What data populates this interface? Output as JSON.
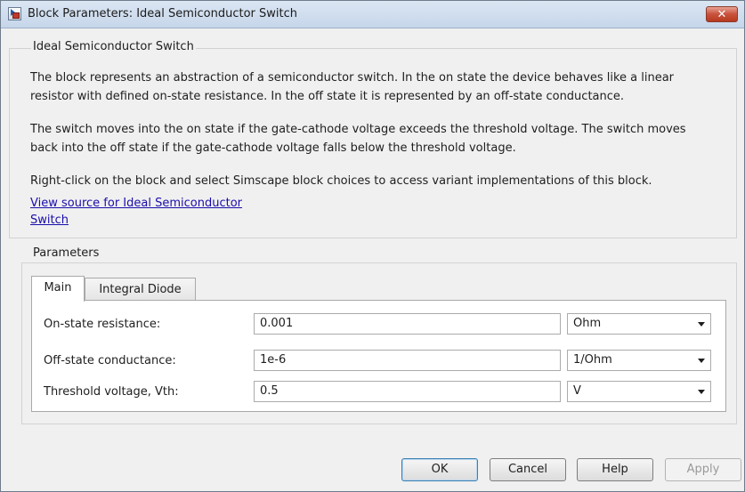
{
  "window": {
    "title": "Block Parameters: Ideal Semiconductor Switch",
    "close_label": "✕"
  },
  "description": {
    "group_title": "Ideal Semiconductor Switch",
    "paragraph1_line1": "The block represents an abstraction of a semiconductor switch. In the on state the device behaves like a linear",
    "paragraph1_line2": "resistor with defined on-state resistance. In the off state it is represented by an off-state conductance.",
    "paragraph2_line1": "The switch moves into the on state if the gate-cathode voltage exceeds the threshold voltage. The switch moves",
    "paragraph2_line2": "back into the off state if the gate-cathode voltage falls below the threshold voltage.",
    "paragraph3": "Right-click on the block and select Simscape block choices to access variant implementations of this block.",
    "link_line1": "View source for Ideal Semiconductor",
    "link_line2": "Switch"
  },
  "parameters": {
    "group_title": "Parameters",
    "tabs": [
      {
        "label": "Main",
        "selected": true
      },
      {
        "label": "Integral Diode",
        "selected": false
      }
    ],
    "rows": [
      {
        "label": "On-state resistance:",
        "value": "0.001",
        "unit": "Ohm"
      },
      {
        "label": "Off-state conductance:",
        "value": "1e-6",
        "unit": "1/Ohm"
      },
      {
        "label": "Threshold voltage, Vth:",
        "value": "0.5",
        "unit": "V"
      }
    ]
  },
  "buttons": {
    "ok": "OK",
    "cancel": "Cancel",
    "help": "Help",
    "apply": "Apply"
  }
}
